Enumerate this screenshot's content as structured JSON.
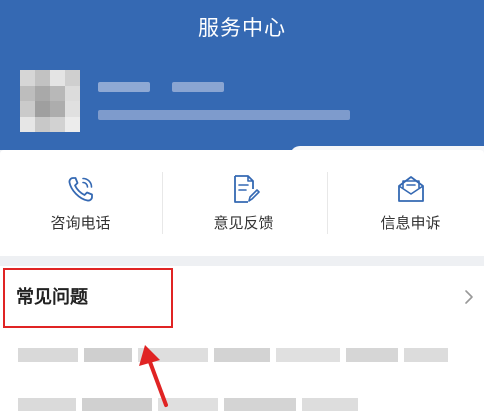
{
  "header": {
    "title": "服务中心"
  },
  "actions": [
    {
      "label": "咨询电话",
      "icon": "phone-icon"
    },
    {
      "label": "意见反馈",
      "icon": "feedback-icon"
    },
    {
      "label": "信息申诉",
      "icon": "mail-icon"
    }
  ],
  "faq": {
    "title": "常见问题"
  },
  "colors": {
    "header_bg": "#3569b3",
    "accent": "#3569b3",
    "highlight": "#e02424"
  }
}
